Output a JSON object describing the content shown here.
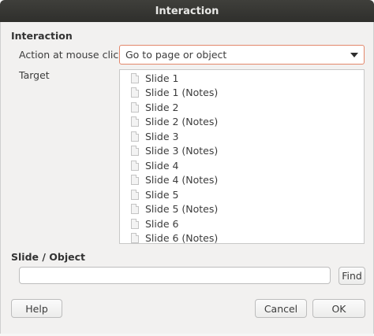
{
  "window": {
    "title": "Interaction"
  },
  "interaction": {
    "heading": "Interaction",
    "action_label": "Action at mouse click:",
    "action_value": "Go to page or object",
    "target_label": "Target",
    "targets": [
      "Slide 1",
      "Slide 1 (Notes)",
      "Slide 2",
      "Slide 2 (Notes)",
      "Slide 3",
      "Slide 3 (Notes)",
      "Slide 4",
      "Slide 4 (Notes)",
      "Slide 5",
      "Slide 5 (Notes)",
      "Slide 6",
      "Slide 6 (Notes)"
    ]
  },
  "slide_object": {
    "heading": "Slide / Object",
    "input_value": "",
    "find_label": "Find"
  },
  "buttons": {
    "help": "Help",
    "cancel": "Cancel",
    "ok": "OK"
  },
  "icons": {
    "target_item": "document-icon",
    "dropdown": "chevron-down-icon"
  },
  "colors": {
    "focus_border": "#e3876b",
    "titlebar": "#3a3a37"
  }
}
